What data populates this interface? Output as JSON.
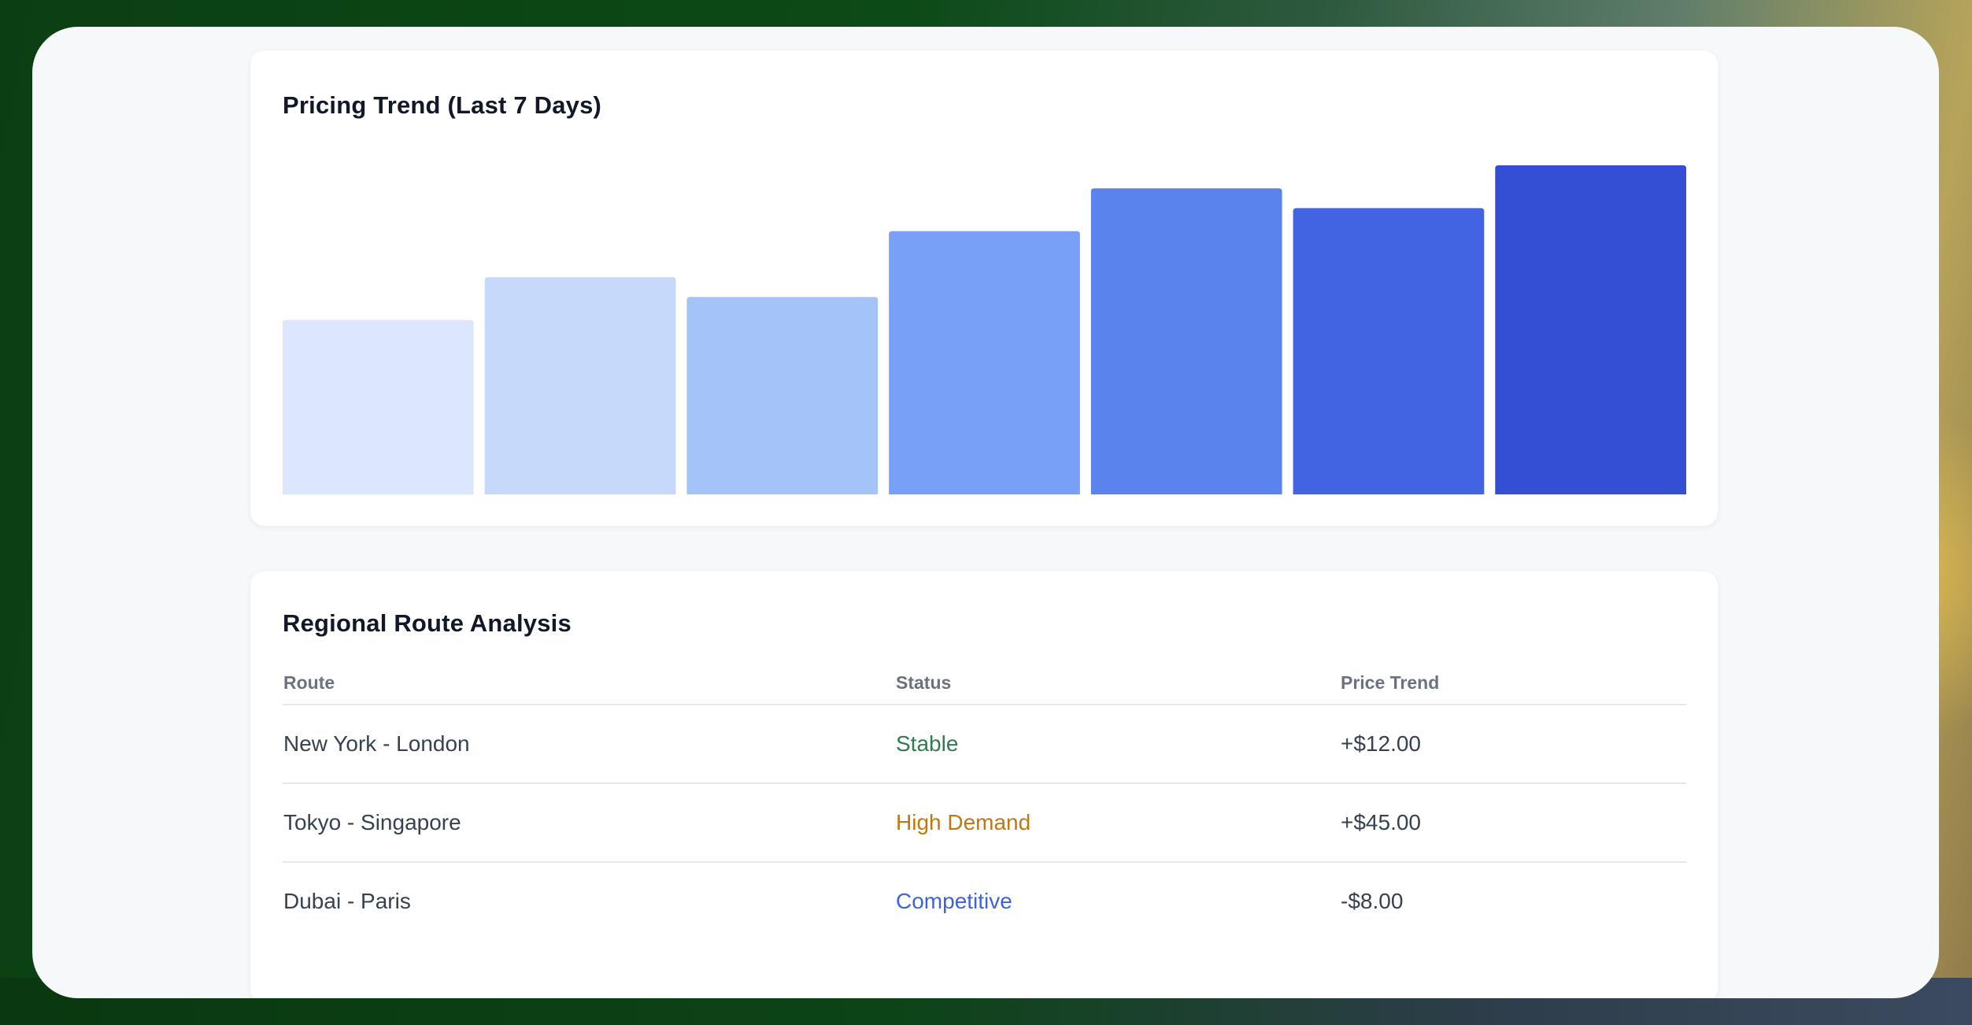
{
  "pricing_trend": {
    "title": "Pricing Trend (Last 7 Days)",
    "chart_data": {
      "type": "bar",
      "title": "Pricing Trend (Last 7 Days)",
      "categories": [],
      "values": [
        53,
        66,
        60,
        80,
        93,
        87,
        100
      ],
      "colors": [
        "#dce7fd",
        "#c6d9fb",
        "#a4c3f9",
        "#77a0f6",
        "#5a83ee",
        "#4263e2",
        "#344fd3"
      ],
      "ylim": [
        0,
        100
      ],
      "grid": false
    }
  },
  "route_analysis": {
    "title": "Regional Route Analysis",
    "columns": [
      "Route",
      "Status",
      "Price Trend"
    ],
    "rows": [
      {
        "route": "New York - London",
        "status": "Stable",
        "status_color": "#2f7d4f",
        "price_trend": "+$12.00"
      },
      {
        "route": "Tokyo - Singapore",
        "status": "High Demand",
        "status_color": "#c2770f",
        "price_trend": "+$45.00"
      },
      {
        "route": "Dubai - Paris",
        "status": "Competitive",
        "status_color": "#3f63d8",
        "price_trend": "-$8.00"
      }
    ]
  }
}
